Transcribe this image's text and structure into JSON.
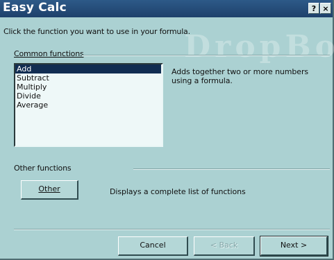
{
  "window": {
    "title": "Easy Calc"
  },
  "titlebar_buttons": {
    "help": "?",
    "close": "×"
  },
  "instructions": "Click the function you want to use in your formula.",
  "common": {
    "label": "Common functions",
    "items": [
      "Add",
      "Subtract",
      "Multiply",
      "Divide",
      "Average"
    ],
    "selected": "Add",
    "description_line1": "Adds together two or more numbers",
    "description_line2": "using a formula."
  },
  "other": {
    "label": "Other functions",
    "button_label": "Other",
    "description": "Displays a complete list of functions"
  },
  "buttons": {
    "cancel": "Cancel",
    "back": "< Back",
    "next": "Next >"
  },
  "watermark": "DropBoo"
}
